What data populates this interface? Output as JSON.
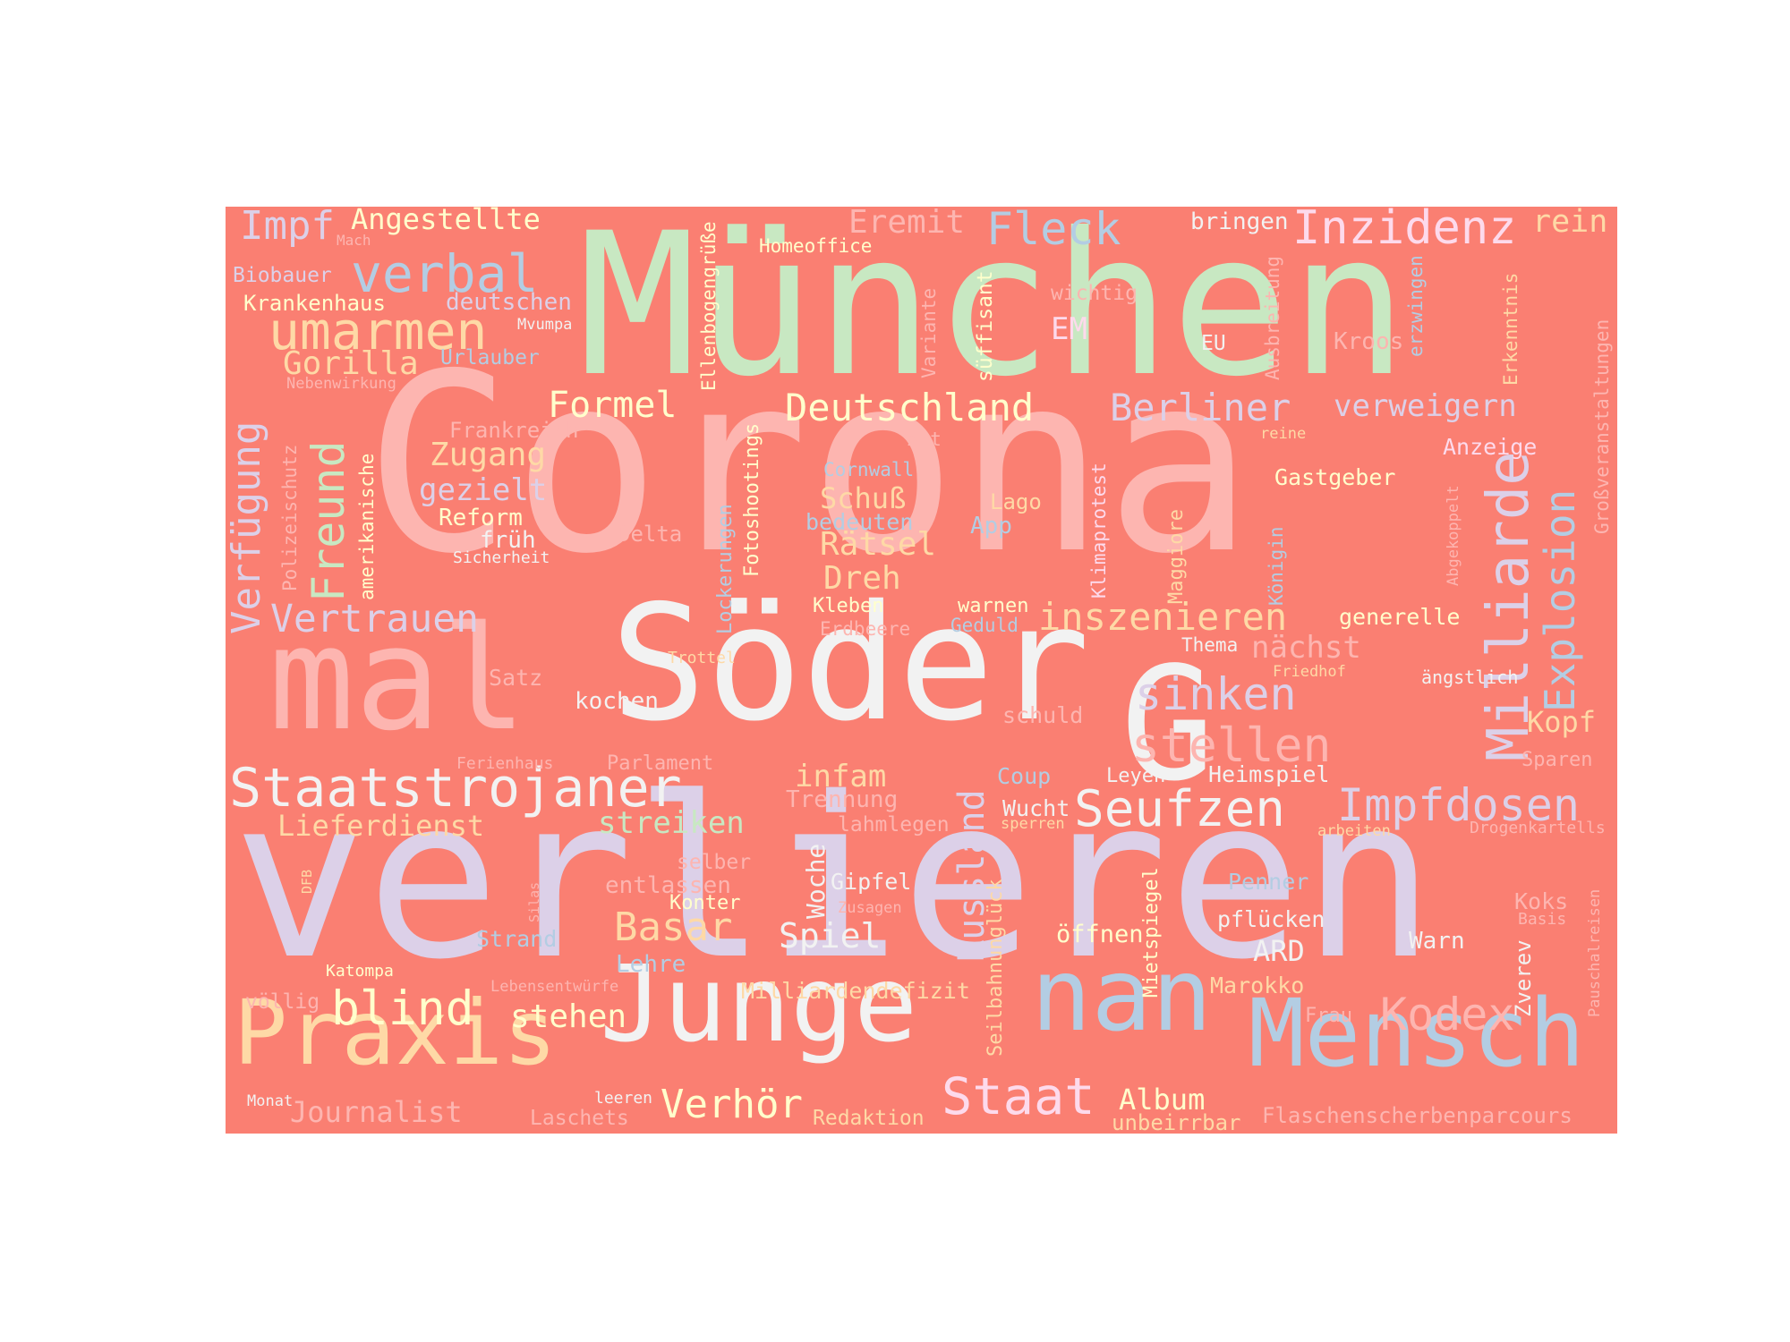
{
  "colors": {
    "background": "#FA7F72",
    "page": "#ffffff"
  },
  "words": [
    {
      "text": "Corona",
      "color": "#FDB5B0"
    },
    {
      "text": "verlieren",
      "color": "#DCD0E8"
    },
    {
      "text": "München",
      "color": "#C8E8C2"
    },
    {
      "text": "Söder",
      "color": "#F2F2F2"
    },
    {
      "text": "mal",
      "color": "#FDB5B0"
    },
    {
      "text": "G",
      "color": "#F2F2F2"
    },
    {
      "text": "nan",
      "color": "#B3CDE3"
    },
    {
      "text": "Junge",
      "color": "#F2F2F2"
    },
    {
      "text": "Praxis",
      "color": "#FED9A6"
    },
    {
      "text": "Mensch",
      "color": "#B3CDE3"
    },
    {
      "text": "Staatstrojaner",
      "color": "#F2F2F2"
    },
    {
      "text": "Milliarde",
      "color": "#DCD0E8"
    },
    {
      "text": "Explosion",
      "color": "#B3CDE3"
    },
    {
      "text": "Freund",
      "color": "#C8E8C2"
    },
    {
      "text": "Verfügung",
      "color": "#DCD0E8"
    },
    {
      "text": "Russland",
      "color": "#DCD0E8"
    },
    {
      "text": "Seufzen",
      "color": "#F2F2F2"
    },
    {
      "text": "Impfdosen",
      "color": "#DCD0E8"
    },
    {
      "text": "Staat",
      "color": "#FDDAEC"
    },
    {
      "text": "umarmen",
      "color": "#FED9A6"
    },
    {
      "text": "verbal",
      "color": "#B3CDE3"
    },
    {
      "text": "Inzidenz",
      "color": "#FDDAEC"
    },
    {
      "text": "Fleck",
      "color": "#B3CDE3"
    },
    {
      "text": "Deutschland",
      "color": "#FFFFCC"
    },
    {
      "text": "Berliner",
      "color": "#DCD0E8"
    },
    {
      "text": "inszenieren",
      "color": "#FED9A6"
    },
    {
      "text": "Vertrauen",
      "color": "#DCD0E8"
    },
    {
      "text": "stellen",
      "color": "#FDB5B0"
    },
    {
      "text": "sinken",
      "color": "#DCD0E8"
    },
    {
      "text": "blind",
      "color": "#FFFFCC"
    },
    {
      "text": "Basar",
      "color": "#FED9A6"
    },
    {
      "text": "Kodex",
      "color": "#FDB5B0"
    },
    {
      "text": "Verhör",
      "color": "#FFFFCC"
    },
    {
      "text": "Formel",
      "color": "#FFFFCC"
    },
    {
      "text": "Impf",
      "color": "#DCD0E8"
    },
    {
      "text": "Angestellte",
      "color": "#FFFFCC"
    },
    {
      "text": "Eremit",
      "color": "#FDB5B0"
    },
    {
      "text": "rein",
      "color": "#FED9A6"
    },
    {
      "text": "bringen",
      "color": "#F2F2F2"
    },
    {
      "text": "Homeoffice",
      "color": "#FFFFCC"
    },
    {
      "text": "Mach",
      "color": "#FDB5B0"
    },
    {
      "text": "Biobauer",
      "color": "#DCD0E8"
    },
    {
      "text": "Krankenhaus",
      "color": "#FFFFCC"
    },
    {
      "text": "deutschen",
      "color": "#DCD0E8"
    },
    {
      "text": "Mvumpa",
      "color": "#F2F2F2"
    },
    {
      "text": "Gorilla",
      "color": "#FED9A6"
    },
    {
      "text": "Urlauber",
      "color": "#B3CDE3"
    },
    {
      "text": "Nebenwirkung",
      "color": "#FDB5B0"
    },
    {
      "text": "Frankreich",
      "color": "#FDB5B0"
    },
    {
      "text": "Zugang",
      "color": "#FED9A6"
    },
    {
      "text": "gezielt",
      "color": "#DCD0E8"
    },
    {
      "text": "Reform",
      "color": "#FFFFCC"
    },
    {
      "text": "früh",
      "color": "#F2F2F2"
    },
    {
      "text": "Sicherheit",
      "color": "#F2F2F2"
    },
    {
      "text": "Delta",
      "color": "#FDB5B0"
    },
    {
      "text": "Satz",
      "color": "#FDB5B0"
    },
    {
      "text": "kochen",
      "color": "#F2F2F2"
    },
    {
      "text": "Trottel",
      "color": "#FED9A6"
    },
    {
      "text": "Erdbeere",
      "color": "#FDB5B0"
    },
    {
      "text": "Kleben",
      "color": "#FFFFCC"
    },
    {
      "text": "Schuß",
      "color": "#FED9A6"
    },
    {
      "text": "bedeuten",
      "color": "#B3CDE3"
    },
    {
      "text": "Rätsel",
      "color": "#FED9A6"
    },
    {
      "text": "Dreh",
      "color": "#FED9A6"
    },
    {
      "text": "Cornwall",
      "color": "#B3CDE3"
    },
    {
      "text": "Art",
      "color": "#FDB5B0"
    },
    {
      "text": "Lago",
      "color": "#FED9A6"
    },
    {
      "text": "App",
      "color": "#B3CDE3"
    },
    {
      "text": "warnen",
      "color": "#FFFFCC"
    },
    {
      "text": "Geduld",
      "color": "#B3CDE3"
    },
    {
      "text": "Thema",
      "color": "#F2F2F2"
    },
    {
      "text": "nächst",
      "color": "#FDB5B0"
    },
    {
      "text": "Friedhof",
      "color": "#FED9A6"
    },
    {
      "text": "generelle",
      "color": "#FFFFCC"
    },
    {
      "text": "ängstlich",
      "color": "#F2F2F2"
    },
    {
      "text": "Kopf",
      "color": "#FED9A6"
    },
    {
      "text": "Sparen",
      "color": "#FDB5B0"
    },
    {
      "text": "Gastgeber",
      "color": "#FFFFCC"
    },
    {
      "text": "reine",
      "color": "#FED9A6"
    },
    {
      "text": "Anzeige",
      "color": "#FDDAEC"
    },
    {
      "text": "verweigern",
      "color": "#DCD0E8"
    },
    {
      "text": "Kroos",
      "color": "#FDB5B0"
    },
    {
      "text": "EU",
      "color": "#F2F2F2"
    },
    {
      "text": "EM",
      "color": "#FDDAEC"
    },
    {
      "text": "wichtig",
      "color": "#FDB5B0"
    },
    {
      "text": "schuld",
      "color": "#FDB5B0"
    },
    {
      "text": "Parlament",
      "color": "#FDB5B0"
    },
    {
      "text": "Ferienhaus",
      "color": "#FDB5B0"
    },
    {
      "text": "infam",
      "color": "#FED9A6"
    },
    {
      "text": "Trennung",
      "color": "#FDB5B0"
    },
    {
      "text": "streiken",
      "color": "#C8E8C2"
    },
    {
      "text": "Lieferdienst",
      "color": "#FED9A6"
    },
    {
      "text": "lahmlegen",
      "color": "#FDB5B0"
    },
    {
      "text": "Coup",
      "color": "#B3CDE3"
    },
    {
      "text": "Wucht",
      "color": "#F2F2F2"
    },
    {
      "text": "sperren",
      "color": "#FED9A6"
    },
    {
      "text": "Leyen",
      "color": "#F2F2F2"
    },
    {
      "text": "Heimspiel",
      "color": "#F2F2F2"
    },
    {
      "text": "arbeiten",
      "color": "#FED9A6"
    },
    {
      "text": "Drogenkartells",
      "color": "#FDB5B0"
    },
    {
      "text": "selber",
      "color": "#FDB5B0"
    },
    {
      "text": "entlassen",
      "color": "#FDB5B0"
    },
    {
      "text": "Gipfel",
      "color": "#F2F2F2"
    },
    {
      "text": "Konter",
      "color": "#FFFFCC"
    },
    {
      "text": "Zusagen",
      "color": "#FDB5B0"
    },
    {
      "text": "Strand",
      "color": "#B3CDE3"
    },
    {
      "text": "Spiel",
      "color": "#F2F2F2"
    },
    {
      "text": "Lehre",
      "color": "#B3CDE3"
    },
    {
      "text": "öffnen",
      "color": "#FFFFCC"
    },
    {
      "text": "ARD",
      "color": "#F2F2F2"
    },
    {
      "text": "Penner",
      "color": "#B3CDE3"
    },
    {
      "text": "pflücken",
      "color": "#F2F2F2"
    },
    {
      "text": "Warn",
      "color": "#F2F2F2"
    },
    {
      "text": "Koks",
      "color": "#FDB5B0"
    },
    {
      "text": "Basis",
      "color": "#FDB5B0"
    },
    {
      "text": "Katompa",
      "color": "#FFFFCC"
    },
    {
      "text": "völlig",
      "color": "#FDB5B0"
    },
    {
      "text": "Lebensentwürfe",
      "color": "#FDB5B0"
    },
    {
      "text": "Milliardendefizit",
      "color": "#FED9A6"
    },
    {
      "text": "stehen",
      "color": "#FFFFCC"
    },
    {
      "text": "Marokko",
      "color": "#FED9A6"
    },
    {
      "text": "Frau",
      "color": "#FDB5B0"
    },
    {
      "text": "Monat",
      "color": "#F2F2F2"
    },
    {
      "text": "Journalist",
      "color": "#FDB5B0"
    },
    {
      "text": "leeren",
      "color": "#F2F2F2"
    },
    {
      "text": "Laschets",
      "color": "#FDB5B0"
    },
    {
      "text": "Redaktion",
      "color": "#FED9A6"
    },
    {
      "text": "Album",
      "color": "#FFFFCC"
    },
    {
      "text": "unbeirrbar",
      "color": "#FED9A6"
    },
    {
      "text": "Flaschenscherbenparcours",
      "color": "#FDB5B0"
    },
    {
      "text": "Ellenbogengrüße",
      "color": "#FFFFCC"
    },
    {
      "text": "Fotoshootings",
      "color": "#FFFFCC"
    },
    {
      "text": "Lockerungen",
      "color": "#B3CDE3"
    },
    {
      "text": "Variante",
      "color": "#FDB5B0"
    },
    {
      "text": "süffisant",
      "color": "#FFFFCC"
    },
    {
      "text": "amerikanische",
      "color": "#FFFFCC"
    },
    {
      "text": "Polizeischutz",
      "color": "#FDB5B0"
    },
    {
      "text": "Klimaprotest",
      "color": "#FDDAEC"
    },
    {
      "text": "Maggiore",
      "color": "#FED9A6"
    },
    {
      "text": "Königin",
      "color": "#B3CDE3"
    },
    {
      "text": "Abgekoppelt",
      "color": "#FDB5B0"
    },
    {
      "text": "Ausbreitung",
      "color": "#FDB5B0"
    },
    {
      "text": "erzwingen",
      "color": "#B3CDE3"
    },
    {
      "text": "Erkenntnis",
      "color": "#FED9A6"
    },
    {
      "text": "Großveranstaltungen",
      "color": "#FDB5B0"
    },
    {
      "text": "Woche",
      "color": "#F2F2F2"
    },
    {
      "text": "Seilbahnunglück",
      "color": "#FED9A6"
    },
    {
      "text": "Mietspiegel",
      "color": "#FFFFCC"
    },
    {
      "text": "Zverev",
      "color": "#F2F2F2"
    },
    {
      "text": "Pauschalreisen",
      "color": "#FDB5B0"
    },
    {
      "text": "DFB",
      "color": "#FED9A6"
    },
    {
      "text": "Silas",
      "color": "#FDB5B0"
    }
  ]
}
